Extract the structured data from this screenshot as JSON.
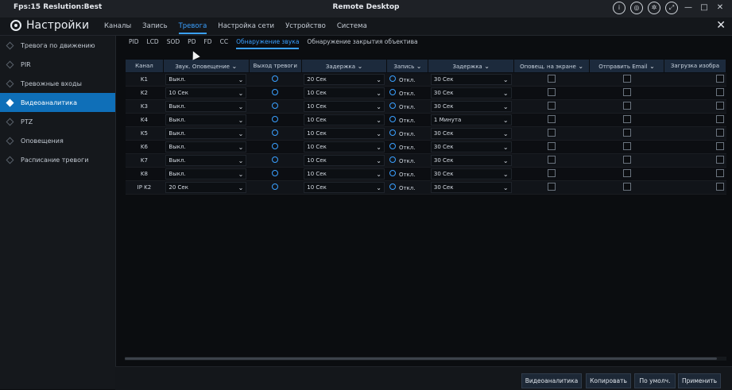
{
  "titlebar": {
    "left": "Fps:15 Reslution:Best",
    "center": "Remote Desktop",
    "icons": [
      "info-icon",
      "record-icon",
      "gear-icon",
      "fullscreen-icon"
    ],
    "minimize": "—",
    "maximize": "□",
    "close": "✕"
  },
  "app": {
    "title": "Настройки",
    "close": "✕"
  },
  "nav": {
    "tabs": [
      "Каналы",
      "Запись",
      "Тревога",
      "Настройка сети",
      "Устройство",
      "Система"
    ],
    "active": 2
  },
  "sidebar": {
    "items": [
      "Тревога по движению",
      "PIR",
      "Тревожные входы",
      "Видеоаналитика",
      "PTZ",
      "Оповещения",
      "Расписание тревоги"
    ],
    "active": 3
  },
  "subtabs": {
    "items": [
      "PID",
      "LCD",
      "SOD",
      "PD",
      "FD",
      "CC",
      "Обнаружение звука",
      "Обнаружение закрытия объектива"
    ],
    "active": 6
  },
  "table": {
    "headers": [
      "Канал",
      "Звук. Оповещение",
      "Выход тревоги",
      "Задержка",
      "Запись",
      "Задержка",
      "Оповещ. на экране",
      "Отправить Email",
      "Загрузка изобра"
    ],
    "rows": [
      {
        "channel": "K1",
        "sound": "Выкл.",
        "delay": "20 Сек",
        "rec": "Откл.",
        "rec_delay": "30 Сек"
      },
      {
        "channel": "K2",
        "sound": "10 Сек",
        "delay": "10 Сек",
        "rec": "Откл.",
        "rec_delay": "30 Сек"
      },
      {
        "channel": "K3",
        "sound": "Выкл.",
        "delay": "10 Сек",
        "rec": "Откл.",
        "rec_delay": "30 Сек"
      },
      {
        "channel": "K4",
        "sound": "Выкл.",
        "delay": "10 Сек",
        "rec": "Откл.",
        "rec_delay": "1 Минута"
      },
      {
        "channel": "K5",
        "sound": "Выкл.",
        "delay": "10 Сек",
        "rec": "Откл.",
        "rec_delay": "30 Сек"
      },
      {
        "channel": "K6",
        "sound": "Выкл.",
        "delay": "10 Сек",
        "rec": "Откл.",
        "rec_delay": "30 Сек"
      },
      {
        "channel": "K7",
        "sound": "Выкл.",
        "delay": "10 Сек",
        "rec": "Откл.",
        "rec_delay": "30 Сек"
      },
      {
        "channel": "K8",
        "sound": "Выкл.",
        "delay": "10 Сек",
        "rec": "Откл.",
        "rec_delay": "30 Сек"
      },
      {
        "channel": "IP K2",
        "sound": "20 Сек",
        "delay": "10 Сек",
        "rec": "Откл.",
        "rec_delay": "30 Сек"
      }
    ]
  },
  "buttons": {
    "analytics": "Видеоаналитика",
    "copy": "Копировать",
    "default": "По умолч.",
    "apply": "Применить"
  },
  "colors": {
    "accent": "#3aa0ff",
    "active_sidebar": "#0f6fb8",
    "header": "#1c2a3c"
  }
}
